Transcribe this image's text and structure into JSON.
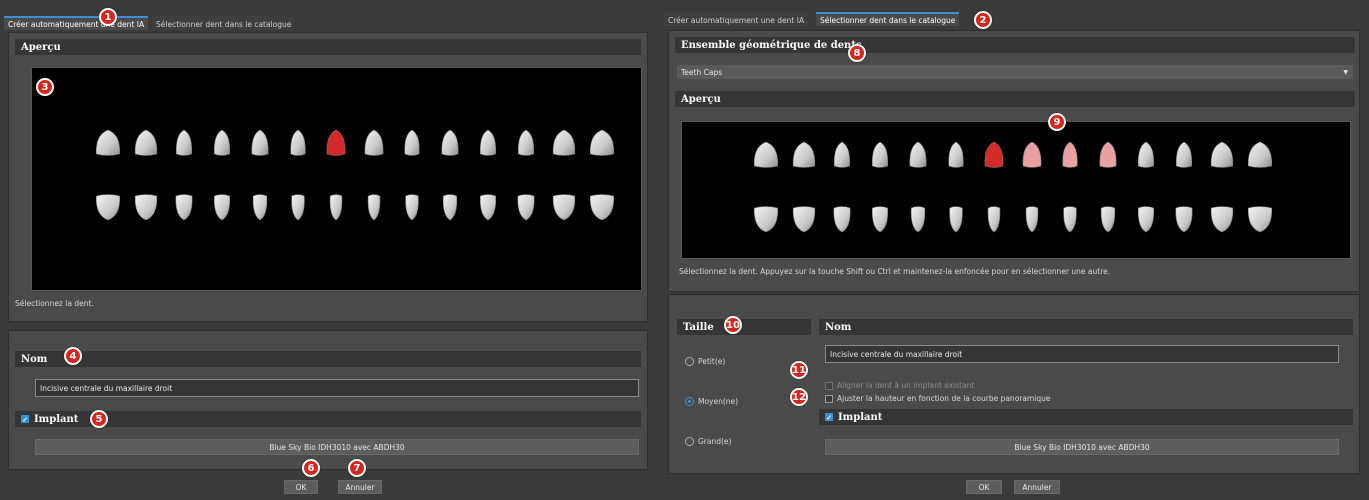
{
  "left": {
    "tabs": [
      "Créer automatiquement une dent IA",
      "Sélectionner dent dans le catalogue"
    ],
    "preview_header": "Aperçu",
    "preview_hint": "Sélectionnez la dent.",
    "name_header": "Nom",
    "name_value": "Incisive centrale du maxillaire droit",
    "implant_label": "Implant",
    "implant_button": "Blue Sky Bio IDH3010 avec ABDH30",
    "ok": "OK",
    "cancel": "Annuler"
  },
  "right": {
    "tabs": [
      "Créer automatiquement une dent IA",
      "Sélectionner dent dans le catalogue"
    ],
    "set_header": "Ensemble géométrique de dents",
    "set_value": "Teeth Caps",
    "preview_header": "Aperçu",
    "preview_hint": "Sélectionnez la dent. Appuyez sur la touche Shift ou Ctrl et maintenez-la enfoncée pour en sélectionner une autre.",
    "size_header": "Taille",
    "size_options": [
      "Petit(e)",
      "Moyen(ne)",
      "Grand(e)"
    ],
    "size_selected": "Moyen(ne)",
    "name_header": "Nom",
    "name_value": "Incisive centrale du maxillaire droit",
    "align_label": "Aligner la dent à un implant existant",
    "adjust_label": "Ajuster la hauteur en fonction de la courbe panoramique",
    "implant_label": "Implant",
    "implant_button": "Blue Sky Bio IDH3010 avec ABDH30",
    "ok": "OK",
    "cancel": "Annuler"
  },
  "markers": [
    "1",
    "2",
    "3",
    "4",
    "5",
    "6",
    "7",
    "8",
    "9",
    "10",
    "11",
    "12"
  ],
  "colors": {
    "accent": "#3b8fd9",
    "marker": "#d7261e",
    "selected_tooth": "#d42a2a",
    "highlight_tooth": "#e8a0a0"
  }
}
